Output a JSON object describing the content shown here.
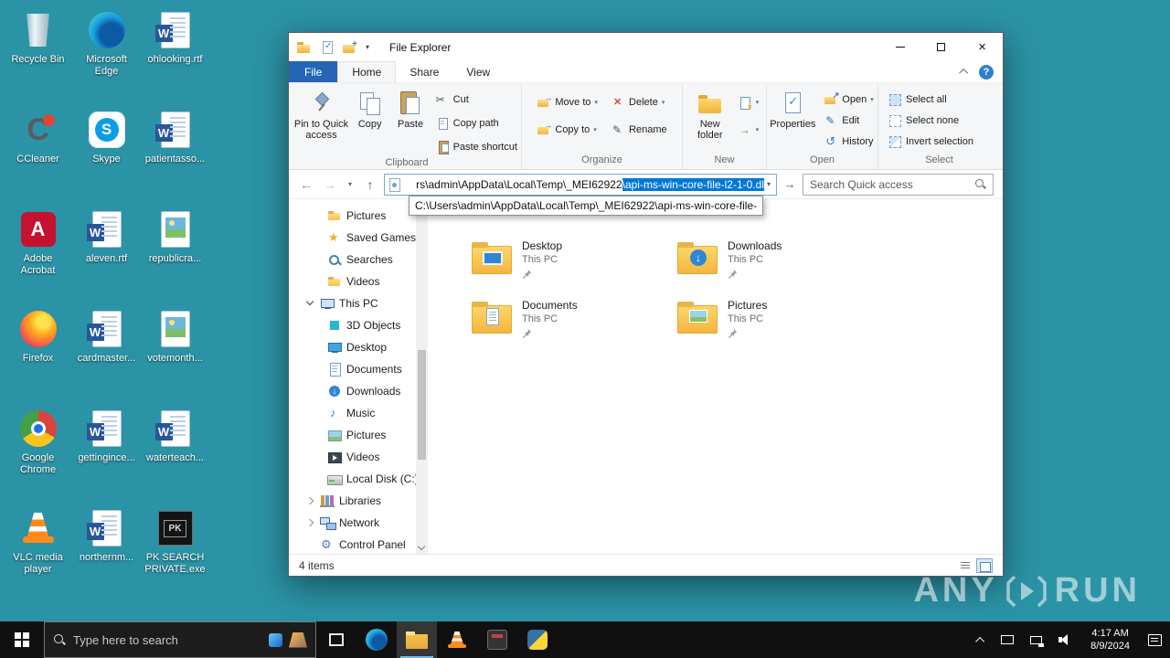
{
  "colors": {
    "desktop_bg": "#2b93a6",
    "accent": "#0078d7",
    "taskbar_bg": "#101010",
    "file_tab_bg": "#2465b5",
    "folder_yellow": "#f7c04a",
    "selection_bg": "#0078d7"
  },
  "desktop": {
    "icons": [
      {
        "label": "Recycle Bin",
        "icon": "recycle-bin"
      },
      {
        "label": "Microsoft Edge",
        "icon": "edge"
      },
      {
        "label": "ohlooking.rtf",
        "icon": "word-document"
      },
      {
        "label": "CCleaner",
        "icon": "ccleaner"
      },
      {
        "label": "Skype",
        "icon": "skype"
      },
      {
        "label": "patientasso...",
        "icon": "word-document"
      },
      {
        "label": "Adobe Acrobat",
        "icon": "acrobat"
      },
      {
        "label": "aleven.rtf",
        "icon": "word-document"
      },
      {
        "label": "republicra...",
        "icon": "image-file"
      },
      {
        "label": "Firefox",
        "icon": "firefox"
      },
      {
        "label": "cardmaster...",
        "icon": "word-document"
      },
      {
        "label": "votemonth...",
        "icon": "image-file"
      },
      {
        "label": "Google Chrome",
        "icon": "chrome"
      },
      {
        "label": "gettingince...",
        "icon": "word-document"
      },
      {
        "label": "waterteach...",
        "icon": "word-document"
      },
      {
        "label": "VLC media player",
        "icon": "vlc"
      },
      {
        "label": "northernm...",
        "icon": "word-document"
      },
      {
        "label": "PK SEARCH PRIVATE.exe",
        "icon": "pk-search-exe"
      }
    ]
  },
  "explorer": {
    "title": "File Explorer",
    "tabs": {
      "file": "File",
      "home": "Home",
      "share": "Share",
      "view": "View"
    },
    "ribbon": {
      "clipboard": {
        "group": "Clipboard",
        "pin_to_quick_access": "Pin to Quick access",
        "copy": "Copy",
        "paste": "Paste",
        "cut": "Cut",
        "copy_path": "Copy path",
        "paste_shortcut": "Paste shortcut"
      },
      "organize": {
        "group": "Organize",
        "move_to": "Move to",
        "copy_to": "Copy to",
        "delete": "Delete",
        "rename": "Rename"
      },
      "new": {
        "group": "New",
        "new_folder": "New folder"
      },
      "open": {
        "group": "Open",
        "properties": "Properties",
        "open": "Open",
        "edit": "Edit",
        "history": "History"
      },
      "select": {
        "group": "Select",
        "select_all": "Select all",
        "select_none": "Select none",
        "invert_selection": "Invert selection"
      }
    },
    "address": {
      "visible_path": "rs\\admin\\AppData\\Local\\Temp\\_MEI62922",
      "selected_text": "\\api-ms-win-core-file-l2-1-0.dl",
      "suggestion": "C:\\Users\\admin\\AppData\\Local\\Temp\\_MEI62922\\api-ms-win-core-file-",
      "search_placeholder": "Search Quick access"
    },
    "nav": [
      {
        "label": "Pictures",
        "icon": "folder"
      },
      {
        "label": "Saved Games",
        "icon": "saved-games-star"
      },
      {
        "label": "Searches",
        "icon": "search-folder"
      },
      {
        "label": "Videos",
        "icon": "folder"
      },
      {
        "label": "This PC",
        "icon": "computer"
      },
      {
        "label": "3D Objects",
        "icon": "3d-cube"
      },
      {
        "label": "Desktop",
        "icon": "desktop-monitor"
      },
      {
        "label": "Documents",
        "icon": "document"
      },
      {
        "label": "Downloads",
        "icon": "download-arrow"
      },
      {
        "label": "Music",
        "icon": "music-note"
      },
      {
        "label": "Pictures",
        "icon": "picture"
      },
      {
        "label": "Videos",
        "icon": "video"
      },
      {
        "label": "Local Disk (C:)",
        "icon": "hard-disk"
      },
      {
        "label": "Libraries",
        "icon": "library"
      },
      {
        "label": "Network",
        "icon": "network"
      },
      {
        "label": "Control Panel",
        "icon": "control-panel"
      }
    ],
    "items": [
      {
        "name": "Desktop",
        "location": "This PC",
        "icon": "desktop-folder",
        "pinned": true
      },
      {
        "name": "Downloads",
        "location": "This PC",
        "icon": "downloads-folder",
        "pinned": true
      },
      {
        "name": "Documents",
        "location": "This PC",
        "icon": "documents-folder",
        "pinned": true
      },
      {
        "name": "Pictures",
        "location": "This PC",
        "icon": "pictures-folder",
        "pinned": true
      }
    ],
    "status_text": "4 items"
  },
  "taskbar": {
    "search_placeholder": "Type here to search",
    "clock": {
      "time": "4:17 AM",
      "date": "8/9/2024"
    }
  },
  "watermark": {
    "any": "ANY",
    "run": "RUN"
  }
}
